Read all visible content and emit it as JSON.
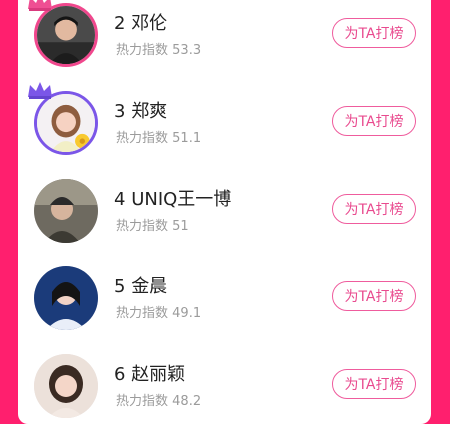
{
  "list": {
    "items": [
      {
        "rank": "2",
        "name": "邓伦",
        "heat_label": "热力指数",
        "heat_value": "53.3",
        "button_label": "为TA打榜",
        "ring": "pink"
      },
      {
        "rank": "3",
        "name": "郑爽",
        "heat_label": "热力指数",
        "heat_value": "51.1",
        "button_label": "为TA打榜",
        "ring": "purple"
      },
      {
        "rank": "4",
        "name": "UNIQ王一博",
        "heat_label": "热力指数",
        "heat_value": "51",
        "button_label": "为TA打榜",
        "ring": "none"
      },
      {
        "rank": "5",
        "name": "金晨",
        "heat_label": "热力指数",
        "heat_value": "49.1",
        "button_label": "为TA打榜",
        "ring": "none"
      },
      {
        "rank": "6",
        "name": "赵丽颖",
        "heat_label": "热力指数",
        "heat_value": "48.2",
        "button_label": "为TA打榜",
        "ring": "none"
      }
    ]
  },
  "colors": {
    "background": "#ff1f6e",
    "button_accent": "#e94b8f",
    "ring_pink": "#f0478d",
    "ring_purple": "#7b56e8"
  },
  "icons": {
    "crown": "crown-icon"
  }
}
